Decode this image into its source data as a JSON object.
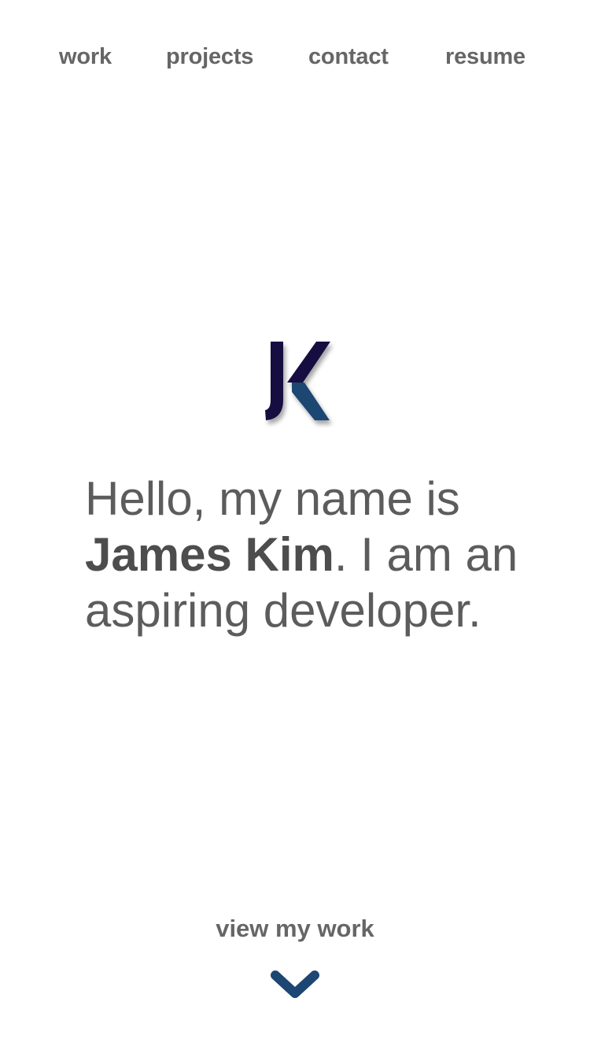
{
  "nav": {
    "items": [
      {
        "label": "work"
      },
      {
        "label": "projects"
      },
      {
        "label": "contact"
      },
      {
        "label": "resume"
      }
    ]
  },
  "logo": {
    "text": "JK",
    "colors": {
      "dark": "#150f3f",
      "blue": "#1d4673"
    }
  },
  "intro": {
    "before": "Hello, my name is",
    "name": "James Kim",
    "after": ". I am an aspiring developer."
  },
  "cta": {
    "label": "view my work",
    "icon": "chevron-down-icon",
    "color": "#1d4673"
  }
}
